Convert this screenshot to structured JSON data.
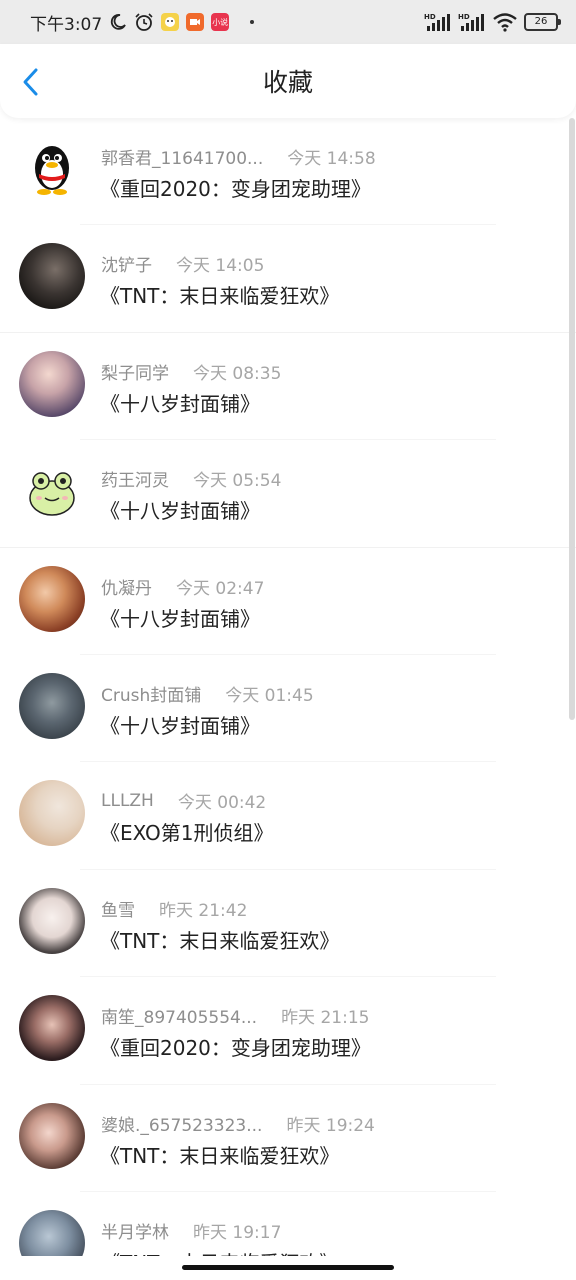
{
  "status_bar": {
    "time": "下午3:07",
    "battery": "26",
    "icons": [
      "moon-icon",
      "alarm-icon",
      "app-badge-yellow",
      "app-badge-orange",
      "app-badge-red",
      "hd-signal-icon",
      "hd-signal-icon",
      "wifi-icon",
      "battery-icon"
    ],
    "red_badge_text": "小说"
  },
  "header": {
    "title": "收藏",
    "back_icon": "chevron-left-icon",
    "accent_color": "#1a8ce8"
  },
  "items": [
    {
      "name": "郭香君_11641700...",
      "time": "今天 14:58",
      "book": "《重回2020：变身团宠助理》",
      "avatar": "penguin"
    },
    {
      "name": "沈铲子",
      "time": "今天 14:05",
      "book": "《TNT：末日来临爱狂欢》",
      "avatar": "dark-portrait"
    },
    {
      "name": "梨子同学",
      "time": "今天 08:35",
      "book": "《十八岁封面铺》",
      "avatar": "girl-with-dog"
    },
    {
      "name": "药王河灵",
      "time": "今天 05:54",
      "book": "《十八岁封面铺》",
      "avatar": "frog"
    },
    {
      "name": "仇凝丹",
      "time": "今天 02:47",
      "book": "《十八岁封面铺》",
      "avatar": "birthday-photo"
    },
    {
      "name": "Crush封面铺",
      "time": "今天 01:45",
      "book": "《十八岁封面铺》",
      "avatar": "blurry-dark"
    },
    {
      "name": "LLLZH",
      "time": "今天 00:42",
      "book": "《EXO第1刑侦组》",
      "avatar": "cat-light"
    },
    {
      "name": "鱼雪",
      "time": "昨天 21:42",
      "book": "《TNT：末日来临爱狂欢》",
      "avatar": "anime-girl"
    },
    {
      "name": "南笙_897405554...",
      "time": "昨天 21:15",
      "book": "《重回2020：变身团宠助理》",
      "avatar": "dark-hair-girl"
    },
    {
      "name": "婆娘._657523323...",
      "time": "昨天 19:24",
      "book": "《TNT：末日来临爱狂欢》",
      "avatar": "selfie"
    },
    {
      "name": "半月学林",
      "time": "昨天 19:17",
      "book": "《TNT：末日来临爱狂欢》",
      "avatar": "partial-photo"
    }
  ]
}
